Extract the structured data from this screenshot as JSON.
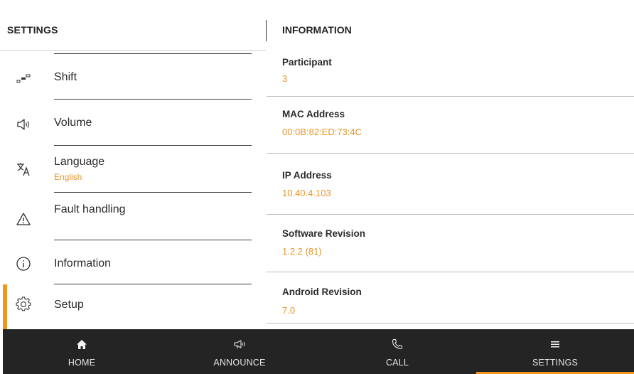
{
  "left_panel": {
    "title": "SETTINGS"
  },
  "right_panel": {
    "title": "INFORMATION"
  },
  "menu": {
    "items": [
      {
        "label": "Shift",
        "sub": "",
        "icon": "shift-icon"
      },
      {
        "label": "Volume",
        "sub": "",
        "icon": "volume-icon"
      },
      {
        "label": "Language",
        "sub": "English",
        "icon": "language-icon"
      },
      {
        "label": "Fault handling",
        "sub": "",
        "icon": "warning-icon"
      },
      {
        "label": "Information",
        "sub": "",
        "icon": "info-icon"
      },
      {
        "label": "Setup",
        "sub": "",
        "icon": "gear-icon"
      }
    ],
    "active": "Setup"
  },
  "info": {
    "rows": [
      {
        "key": "Participant",
        "value": "3"
      },
      {
        "key": "MAC Address",
        "value": "00:0B:82:ED:73:4C"
      },
      {
        "key": "IP Address",
        "value": "10.40.4.103"
      },
      {
        "key": "Software Revision",
        "value": "1.2.2 (81)"
      },
      {
        "key": "Android Revision",
        "value": "7.0"
      }
    ]
  },
  "navbar": {
    "items": [
      {
        "label": "HOME",
        "icon": "home-icon"
      },
      {
        "label": "ANNOUNCE",
        "icon": "megaphone-icon"
      },
      {
        "label": "CALL",
        "icon": "phone-icon"
      },
      {
        "label": "SETTINGS",
        "icon": "menu-icon"
      }
    ],
    "active": "SETTINGS"
  },
  "colors": {
    "accent": "#f0971c",
    "value_text": "#e8952a",
    "navbar_bg": "#242424"
  }
}
